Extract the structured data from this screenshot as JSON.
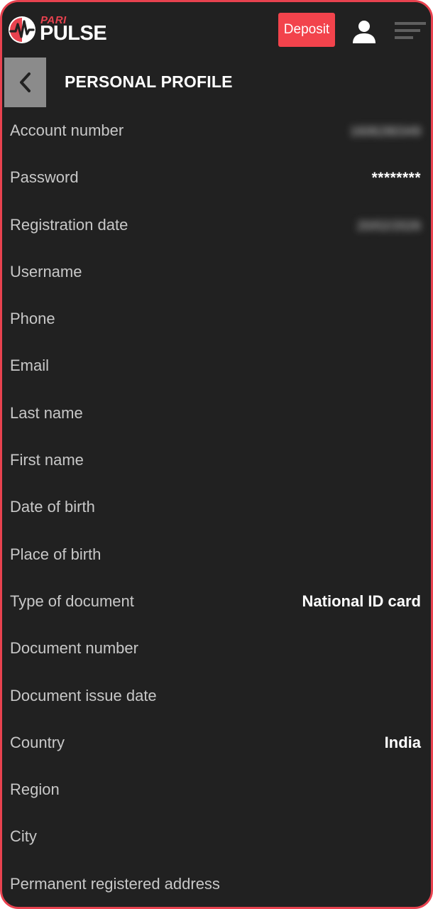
{
  "header": {
    "logo_top": "PARI",
    "logo_bottom": "PULSE",
    "deposit_label": "Deposit"
  },
  "page": {
    "title": "PERSONAL PROFILE"
  },
  "rows": [
    {
      "label": "Account number",
      "value": "1606280349"
    },
    {
      "label": "Password",
      "value": "********"
    },
    {
      "label": "Registration date",
      "value": "20/02/2026"
    },
    {
      "label": "Username",
      "value": ""
    },
    {
      "label": "Phone",
      "value": ""
    },
    {
      "label": "Email",
      "value": ""
    },
    {
      "label": "Last name",
      "value": ""
    },
    {
      "label": "First name",
      "value": ""
    },
    {
      "label": "Date of birth",
      "value": ""
    },
    {
      "label": "Place of birth",
      "value": ""
    },
    {
      "label": "Type of document",
      "value": "National ID card"
    },
    {
      "label": "Document number",
      "value": ""
    },
    {
      "label": "Document issue date",
      "value": ""
    },
    {
      "label": "Country",
      "value": "India"
    },
    {
      "label": "Region",
      "value": ""
    },
    {
      "label": "City",
      "value": ""
    },
    {
      "label": "Permanent registered address",
      "value": ""
    }
  ],
  "colors": {
    "background": "#212121",
    "accent": "#f2434c",
    "frame": "#e8424f",
    "label": "#c8c8c8",
    "value": "#ffffff"
  },
  "icons": {
    "logo": "pari-pulse-logo-icon",
    "user": "user-icon",
    "menu": "hamburger-menu-icon",
    "back": "chevron-left-icon"
  }
}
